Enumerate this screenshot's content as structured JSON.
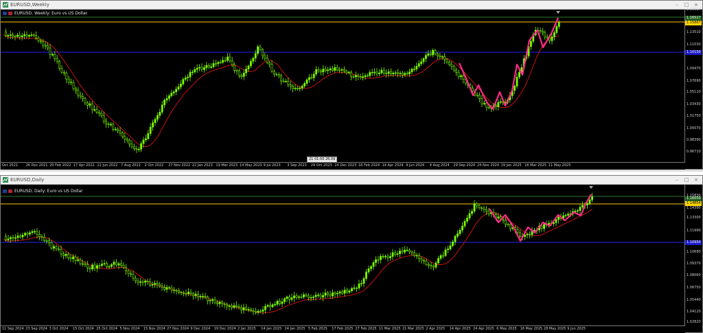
{
  "weekly": {
    "window_title": "EURUSD,Weekly",
    "symbol_label": "EURUSD, Weekly: Euro vs US Dollar",
    "price_labels": [
      "1.16517",
      "1.13510",
      "1.11030",
      "1.09470",
      "1.07690",
      "1.05110",
      "1.03430",
      "1.01750",
      "1.00070",
      "0.98390",
      "0.96710"
    ],
    "badge_green": "1.16517",
    "badge_gold": "1.15867",
    "badge_blue": "1.10150",
    "date_labels": [
      "Oct 2021",
      "26 Dec 2021",
      "20 Feb 2022",
      "17 Apr 2022",
      "12 Jun 2022",
      "7 Aug 2022",
      "2 Oct 2022",
      "27 Nov 2022",
      "22 Jan 2023",
      "19 Mar 2023",
      "14 May 2023",
      "9 Jul 2023",
      "3 Sep 2023",
      "29 Oct 2023",
      "24 Dec 2023",
      "18 Feb 2024",
      "14 Apr 2024",
      "9 Jun 2024",
      "4 Aug 2024",
      "29 Sep 2024",
      "24 Nov 2024",
      "19 Jan 2025",
      "16 Mar 2025",
      "11 May 2025"
    ],
    "cursor_labels": [
      "21",
      "01:00",
      "26.09"
    ],
    "colors": {
      "bull": "#7cfc00",
      "bear": "#e8ffe8",
      "ma": "#cc1111",
      "zigzag": "#ff2a8a",
      "gold": "#c9a400",
      "blue": "#1c1cc8"
    }
  },
  "daily": {
    "window_title": "EURUSD,Daily",
    "symbol_label": "EURUSD, Daily: Euro vs US Dollar",
    "price_labels": [
      "1.15830",
      "1.14390",
      "1.13300",
      "1.11990",
      "1.10690",
      "1.09370",
      "1.08060",
      "1.06750",
      "1.05440",
      "1.04120",
      "1.02820"
    ],
    "badge_green": "1.16050",
    "badge_gold": "1.14854",
    "badge_blue": "1.10950",
    "date_labels": [
      "11 Sep 2024",
      "23 Sep 2024",
      "3 Oct 2024",
      "15 Oct 2024",
      "25 Oct 2024",
      "5 Nov 2024",
      "15 Nov 2024",
      "27 Nov 2024",
      "9 Dec 2024",
      "19 Dec 2024",
      "2 Jan 2025",
      "14 Jan 2025",
      "24 Jan 2025",
      "5 Feb 2025",
      "17 Feb 2025",
      "27 Feb 2025",
      "11 Mar 2025",
      "21 Mar 2025",
      "2 Apr 2025",
      "14 Apr 2025",
      "24 Apr 2025",
      "6 May 2025",
      "16 May 2025",
      "28 May 2025",
      "9 Jun 2025"
    ],
    "colors": {
      "bull": "#7cfc00",
      "bear": "#e8ffe8",
      "ma": "#cc1111",
      "zigzag": "#ff2a8a",
      "gold": "#c9a400",
      "blue": "#1c1cc8"
    }
  },
  "window_controls": {
    "minimize": "–",
    "maximize": "□",
    "close": "×"
  }
}
